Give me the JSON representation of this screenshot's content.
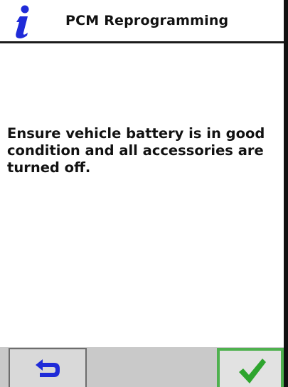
{
  "header": {
    "title": "PCM Reprogramming",
    "icon": "info-icon",
    "icon_color": "#1f2bd8"
  },
  "message": {
    "text": "Ensure vehicle battery is in good condition and all accessories are turned off."
  },
  "footer": {
    "back_button_icon": "back-arrow-icon",
    "back_button_color": "#1f2bd8",
    "confirm_button_icon": "checkmark-icon",
    "confirm_button_color": "#2ea52e"
  }
}
